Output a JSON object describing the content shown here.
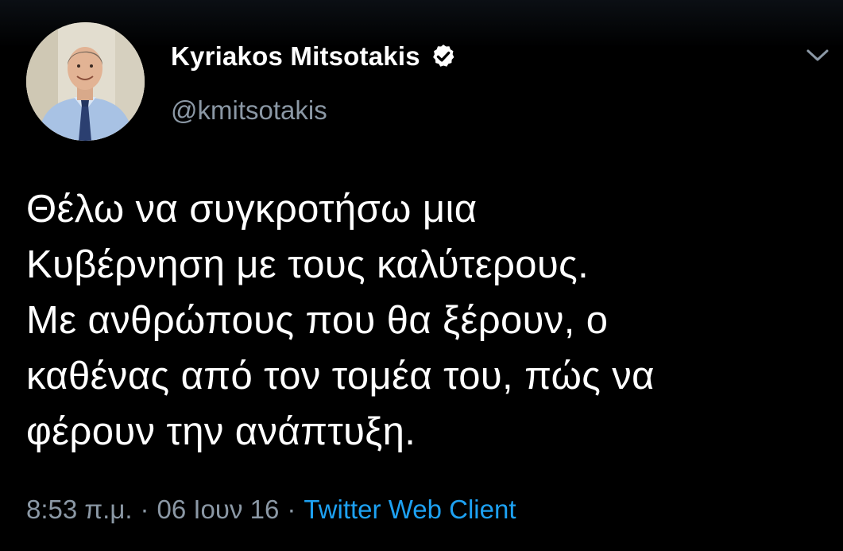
{
  "tweet": {
    "author": {
      "display_name": "Kyriakos Mitsotakis",
      "handle": "@kmitsotakis",
      "verified_icon": "verified-badge-icon",
      "avatar": "profile-photo"
    },
    "menu_icon": "chevron-down-icon",
    "text_lines": [
      "Θέλω να συγκροτήσω μια",
      "Κυβέρνηση με τους καλύτερους.",
      "Με ανθρώπους που θα ξέρουν, ο",
      "καθένας από τον τομέα του, πώς να",
      "φέρουν την ανάπτυξη."
    ],
    "meta": {
      "time": "8:53 π.μ.",
      "separator": "·",
      "date": "06 Ιουν 16",
      "client": "Twitter Web Client"
    }
  },
  "colors": {
    "background": "#000000",
    "text": "#ffffff",
    "secondary_text": "#8b98a5",
    "link": "#1da1f2"
  }
}
